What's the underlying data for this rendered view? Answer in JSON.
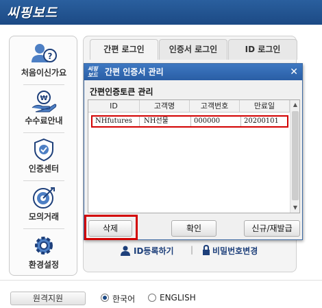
{
  "brand": "씨핑보드",
  "sidebar": {
    "items": [
      {
        "label": "처음이신가요",
        "icon": "user-question-icon"
      },
      {
        "label": "수수료안내",
        "icon": "coin-hand-icon"
      },
      {
        "label": "인증센터",
        "icon": "shield-check-icon"
      },
      {
        "label": "모의거래",
        "icon": "target-icon"
      },
      {
        "label": "환경설정",
        "icon": "gear-icon"
      }
    ]
  },
  "tabs": [
    {
      "label": "간편 로그인",
      "active": true
    },
    {
      "label": "인증서 로그인",
      "active": false
    },
    {
      "label": "ID 로그인",
      "active": false
    }
  ],
  "bottom_links": {
    "id_register": "ID등록하기",
    "password_change": "비밀번호변경"
  },
  "modal": {
    "logo": "씨핑보드",
    "title": "간편 인증서 관리",
    "heading": "간편인증토큰 관리",
    "columns": [
      "ID",
      "고객명",
      "고객번호",
      "만료일"
    ],
    "rows": [
      {
        "id": "NHfutures",
        "name": "NH선물",
        "number": "000000",
        "expiry": "20200101"
      }
    ],
    "buttons": {
      "delete": "삭제",
      "confirm": "확인",
      "renew": "신규/재발급"
    },
    "close": "✕"
  },
  "footer": {
    "remote_support": "원격지원",
    "languages": [
      {
        "label": "한국어",
        "selected": true
      },
      {
        "label": "ENGLISH",
        "selected": false
      }
    ]
  },
  "colors": {
    "topbar": "#1c4a85",
    "highlight": "#d20000",
    "link": "#1d3f7a"
  }
}
